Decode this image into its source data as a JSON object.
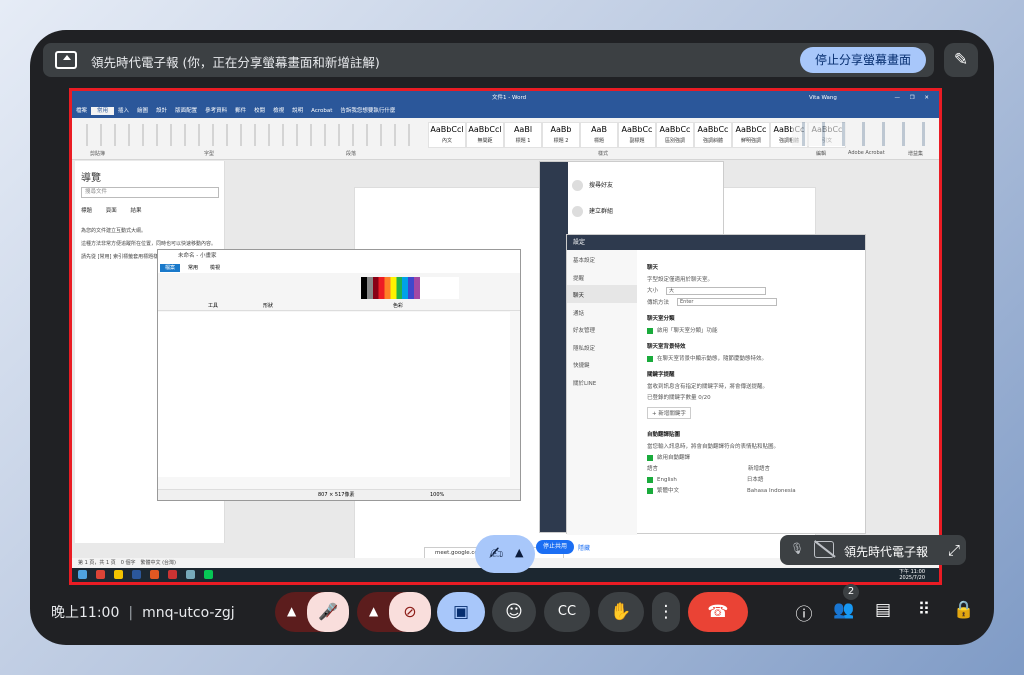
{
  "share_bar": {
    "title": "領先時代電子報 (你，正在分享螢幕畫面和新增註解)",
    "stop_label": "停止分享螢幕畫面"
  },
  "word": {
    "title": "文件1 - Word",
    "user": "Vita Wang",
    "tabs": [
      "檔案",
      "常用",
      "插入",
      "繪圖",
      "設計",
      "版面配置",
      "參考資料",
      "郵件",
      "校閱",
      "檢視",
      "說明",
      "Acrobat",
      "告訴我您想要執行什麼"
    ],
    "share_label": "共用",
    "styles": [
      {
        "sample": "AaBbCcl",
        "name": "內文"
      },
      {
        "sample": "AaBbCcl",
        "name": "無間距"
      },
      {
        "sample": "AaBl",
        "name": "標題 1"
      },
      {
        "sample": "AaBb",
        "name": "標題 2"
      },
      {
        "sample": "AaB",
        "name": "標題"
      },
      {
        "sample": "AaBbCc",
        "name": "副標題"
      },
      {
        "sample": "AaBbCc",
        "name": "區別強調"
      },
      {
        "sample": "AaBbCc",
        "name": "強調斜體"
      },
      {
        "sample": "AaBbCc",
        "name": "鮮明強調"
      },
      {
        "sample": "AaBbCc",
        "name": "強調粗體"
      },
      {
        "sample": "AaBbCc",
        "name": "引文"
      }
    ],
    "groups": [
      "剪貼簿",
      "字型",
      "段落",
      "樣式",
      "編輯",
      "Adobe Acrobat",
      "增益集"
    ],
    "nav": {
      "title": "導覽",
      "search_placeholder": "搜尋文件",
      "tabs": [
        "標題",
        "頁面",
        "結果"
      ],
      "text1": "為您的文件建立互動式大綱。",
      "text2": "這種方法非常方便追蹤所在位置，同時也可以快速移動內容。",
      "text3": "請先從 [常用] 索引標籤套用標題樣式。"
    },
    "status": "第 1 頁，共 1 頁　0 個字　繁體中文 (台灣)"
  },
  "paint": {
    "title": "未命名 - 小畫家",
    "tabs": [
      "檔案",
      "常用",
      "檢視"
    ],
    "groups": [
      "剪貼簿",
      "影像",
      "工具",
      "筆刷",
      "形狀",
      "大小",
      "色彩 1",
      "色彩 2",
      "色彩",
      "編輯色彩",
      "使用小畫家 3D 編輯"
    ],
    "size": "807 × 517像素",
    "zoom": "100%"
  },
  "line": {
    "items": [
      "搜尋好友",
      "建立群組"
    ],
    "settings": {
      "title": "設定",
      "nav": [
        "基本設定",
        "提醒",
        "聊天",
        "通話",
        "好友管理",
        "隱私設定",
        "快捷鍵",
        "關於LINE"
      ],
      "section_chat": "聊天",
      "chat_desc": "字型設定僅適用於聊天室。",
      "size_label": "大小",
      "size_value": "大",
      "send_label": "傳訊方法",
      "send_value": "Enter",
      "split_title": "聊天室分類",
      "split_opt": "啟用「聊天室分類」功能",
      "bg_title": "聊天室背景特效",
      "bg_opt": "在聊天室背景中顯示動態，隨節慶動態特效。",
      "kw_title": "關鍵字提醒",
      "kw_desc": "當收到訊息含有指定的關鍵字時，將會傳送提醒。",
      "kw_count": "已登錄的關鍵字數量 0/20",
      "kw_add": "+ 新增關鍵字",
      "tr_title": "自動翻譯貼圖",
      "tr_desc": "當您輸入訊息時，將會自動翻譯符合的表情貼和貼圖。",
      "tr_opt": "啟用自動翻譯",
      "lang_head": "語言",
      "lang_new": "新增語言",
      "langs": [
        "English",
        "繁體中文"
      ],
      "langs_right": [
        "日本語",
        "Bahasa Indonesia"
      ]
    }
  },
  "taskbar": {
    "time": "下午 11:00",
    "date": "2025/7/20"
  },
  "annotation": {
    "url": "meet.google.com",
    "stop": "停止共用",
    "hide": "隱藏"
  },
  "tile": {
    "name": "領先時代電子報"
  },
  "bottom": {
    "time": "晚上11:00",
    "code": "mnq-utco-zgj",
    "participants": "2"
  },
  "colors": {
    "red_border": "#ea1c24",
    "accent": "#a8c7fa",
    "end_call": "#ea4335",
    "off_btn": "#f9dedc"
  }
}
